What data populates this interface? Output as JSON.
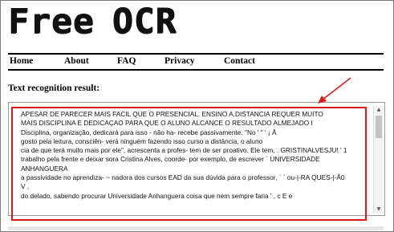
{
  "site": {
    "logo_word_1": "Free",
    "logo_word_2": "OCR"
  },
  "nav": {
    "home": "Home",
    "about": "About",
    "faq": "FAQ",
    "privacy": "Privacy",
    "contact": "Contact"
  },
  "result": {
    "title": "Text recognition result:",
    "lines": [
      "APESAR DE PARECER MAIS FACIL QUE O PRESENCIAL. ENSINO A.DISTANCIA REQUER MUITO",
      "MAIS DISCIPLINA E DEDICAÇAO PARA QUE O ALUNO ALCANCE O RESULTADO ALMEJADO I",
      "Disciplina, organização, dedicará para isso - não ha- recebe passivamente. \"No ' \" '  ¡ Â",
      "gosto pela leitura, consciên- verá ninguém fazendo isso curso a distância, o aluno",
      "cia de que terá muito mais por ele\", acrescenta a profes- tem de ser proativo. Ele tem, . GRISTINALVESJU! ' 1",
      "trabalho pela frente e deixar sora Cristina Alves, coorde- por exemplo, de escrever ` UNIVERSIDADE",
      "ANHANGUERA",
      "a passividade no aprendiza- ~ nadora dos cursos EAD da sua dúvida para o professor, ` ` ou-|-RA QUES-|-Ã0",
      "V ,",
      "do delado, sabendo procurar Universidade Anhanguera coisa que nem sempre faria ' , c E e"
    ]
  },
  "colors": {
    "highlight": "#e01818",
    "arrow": "#e01818"
  }
}
